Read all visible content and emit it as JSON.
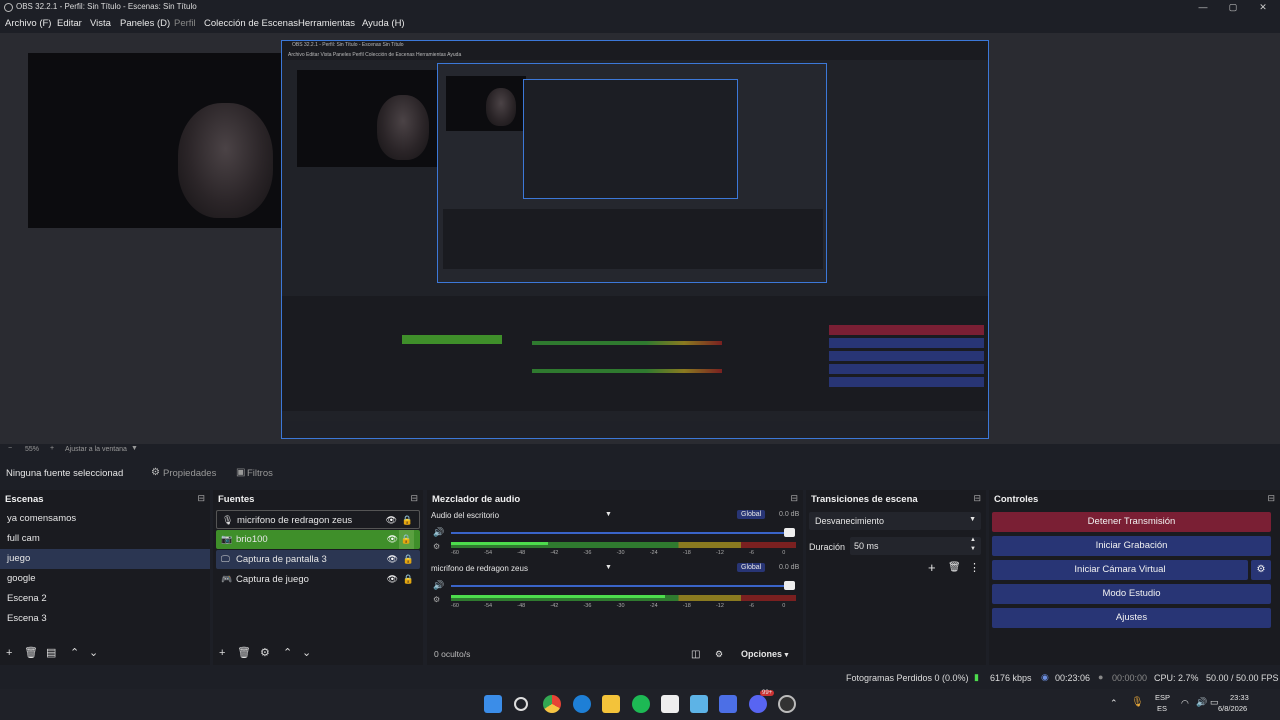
{
  "window": {
    "title": "OBS 32.2.1 - Perfil: Sin Título - Escenas: Sin Título",
    "minimize": "—",
    "maximize": "▢",
    "close": "✕"
  },
  "menu": [
    "Archivo (F)",
    "Editar",
    "Vista",
    "Paneles (D)",
    "Perfil",
    "Colección de Escenas",
    "Herramientas",
    "Ayuda (H)"
  ],
  "zoom": {
    "minus": "−",
    "level": "55%",
    "plus": "+",
    "fit": "Ajustar a la ventana"
  },
  "source_bar": {
    "none": "Ninguna fuente seleccionad",
    "properties": "Propiedades",
    "filters": "Filtros"
  },
  "scenes": {
    "title": "Escenas",
    "items": [
      "ya comensamos",
      "full cam",
      "juego",
      "google",
      "Escena 2",
      "Escena 3"
    ],
    "selected": 2
  },
  "sources": {
    "title": "Fuentes",
    "items": [
      {
        "name": "micrifono de redragon zeus",
        "icon": "mic-icon"
      },
      {
        "name": "brio100",
        "icon": "camera-icon"
      },
      {
        "name": "Captura de pantalla 3",
        "icon": "monitor-icon"
      },
      {
        "name": "Captura de juego",
        "icon": "gamepad-icon"
      }
    ]
  },
  "mixer": {
    "title": "Mezclador de audio",
    "channels": [
      {
        "name": "Audio del escritorio",
        "badge": "Global",
        "db": "0.0 dB",
        "level": 0.28
      },
      {
        "name": "micrifono de redragon zeus",
        "badge": "Global",
        "db": "0.0 dB",
        "level": 0.62
      }
    ],
    "ticks": [
      "-60",
      "-54",
      "-48",
      "-42",
      "-36",
      "-30",
      "-24",
      "-18",
      "-12",
      "-6",
      "0"
    ],
    "hidden": "0 oculto/s",
    "options": "Opciones"
  },
  "transitions": {
    "title": "Transiciones de escena",
    "selected": "Desvanecimiento",
    "duration_label": "Duración",
    "duration": "50 ms"
  },
  "controls": {
    "title": "Controles",
    "stop_stream": "Detener Transmisión",
    "start_record": "Iniciar Grabación",
    "start_vcam": "Iniciar Cámara Virtual",
    "studio": "Modo Estudio",
    "settings": "Ajustes"
  },
  "status": {
    "dropped": "Fotogramas Perdidos 0 (0.0%)",
    "bitrate": "6176 kbps",
    "stream_time": "00:23:06",
    "rec_time": "00:00:00",
    "cpu": "CPU: 2.7%",
    "fps": "50.00 / 50.00 FPS"
  },
  "taskbar": {
    "lang": "ESP",
    "lang2": "ES",
    "time": "23:33",
    "date": "6/8/2026",
    "badge": "99+"
  },
  "colors": {
    "stop": "#7a1f34",
    "blue": "#283575",
    "green": "#3f8f2a",
    "accent": "#3c78d8"
  }
}
